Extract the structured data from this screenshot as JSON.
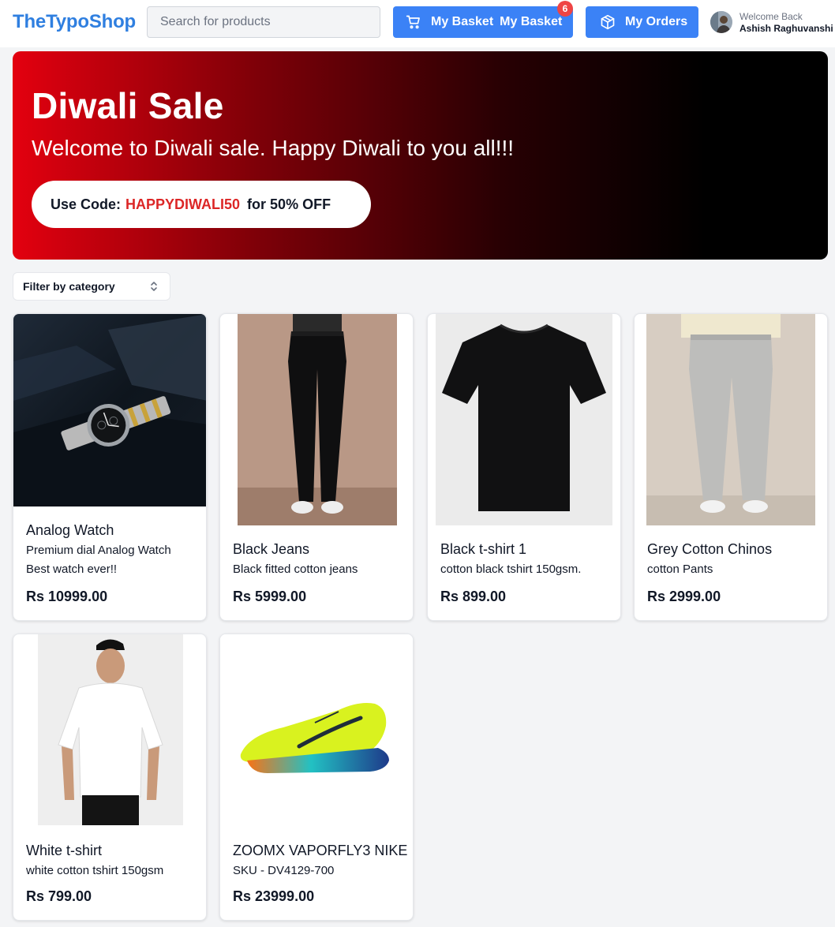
{
  "header": {
    "logo": "TheTypoShop",
    "search_placeholder": "Search for products",
    "basket_label": "My Basket",
    "basket_label_repeat": "My Basket",
    "basket_count": "6",
    "orders_label": "My Orders",
    "welcome": "Welcome Back",
    "user_name": "Ashish Raghuvanshi"
  },
  "banner": {
    "title": "Diwali Sale",
    "subtitle": "Welcome to Diwali sale. Happy Diwali to you all!!!",
    "code_prefix": "Use Code:",
    "code": "HAPPYDIWALI50",
    "code_suffix": "for 50% OFF"
  },
  "filter": {
    "label": "Filter by category"
  },
  "products": [
    {
      "name": "Analog Watch",
      "description": "Premium dial Analog Watch Best watch ever!!",
      "price": "Rs 10999.00",
      "image": "watch-photo"
    },
    {
      "name": "Black Jeans",
      "description": "Black fitted cotton jeans",
      "price": "Rs 5999.00",
      "image": "jeans-photo"
    },
    {
      "name": "Black t-shirt 1",
      "description": "cotton black tshirt 150gsm.",
      "price": "Rs 899.00",
      "image": "tshirt-photo"
    },
    {
      "name": "Grey Cotton Chinos",
      "description": "cotton Pants",
      "price": "Rs 2999.00",
      "image": "chinos-photo"
    },
    {
      "name": "White t-shirt",
      "description": "white cotton tshirt 150gsm",
      "price": "Rs 799.00",
      "image": "white-tshirt-photo"
    },
    {
      "name": "ZOOMX VAPORFLY3 NIKE",
      "description": "SKU - DV4129-700",
      "price": "Rs 23999.00",
      "image": "shoe-photo"
    }
  ],
  "colors": {
    "brand": "#2f7fe0",
    "button": "#3b82f6",
    "badge": "#ef4444",
    "promo_code": "#dc2626"
  }
}
